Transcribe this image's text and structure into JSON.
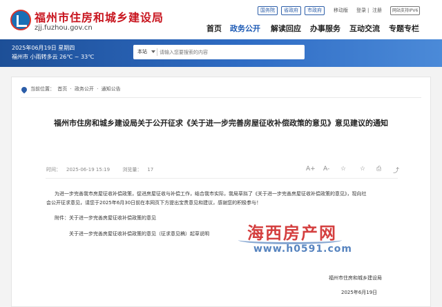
{
  "site": {
    "title": "福州市住房和城乡建设局",
    "domain": "zjj.fuzhou.gov.cn"
  },
  "top_links": [
    "国务院",
    "省政府",
    "市政府"
  ],
  "top_actions": {
    "mobile": "移动版",
    "login": "登录",
    "register": "注册",
    "separator": "|",
    "ipv6": "网站支持IPV6"
  },
  "nav": {
    "items": [
      "首页",
      "政务公开",
      "解读回应",
      "办事服务",
      "互动交流",
      "专题专栏"
    ],
    "active": "政务公开"
  },
  "banner": {
    "date": "2025年06月19日 星期四",
    "weather": "福州市 小雨转多云 26℃ ~ 33℃"
  },
  "search": {
    "scope": "本站",
    "placeholder": "请输入您要搜索的内容"
  },
  "breadcrumb": {
    "prefix": "当前位置：",
    "items": [
      "首页",
      "政务公开",
      "通知公告"
    ],
    "separator": "·"
  },
  "article": {
    "title": "福州市住房和城乡建设局关于公开征求《关于进一步完善房屋征收补偿政策的意见》意见建议的通知",
    "time_label": "时间：",
    "time": "2025-06-19 15:19",
    "views_label": "浏览量：",
    "views": "17",
    "tools": [
      "A+",
      "A-",
      "☆",
      "☆",
      "⎙",
      "⤴"
    ],
    "paragraphs": [
      "为进一步完善我市房屋征收补偿政策，促进房屋征收与补偿工作，结合我市实际，我局草拟了《关于进一步完善房屋征收补偿政策的意见》，现向社",
      "会公开征求意见，请您于2025年6月30日前在本网页下方提出宝贵意见和建议，感谢您的积极参与！"
    ],
    "attachment_label": "附件：关于进一步完善房屋征收补偿政策的意见",
    "attachment_file": "关于进一步完善房屋征收补偿政策的意见（征求意见稿）起草说明",
    "signature": "福州市住房和城乡建设局",
    "date": "2025年6月19日"
  },
  "watermark": {
    "text": "海西房产网",
    "url": "www.h0591.com"
  },
  "colors": {
    "title_red": "#c8141e",
    "nav_blue": "#1e5bb5",
    "banner_blue": "#2f6cc4"
  }
}
